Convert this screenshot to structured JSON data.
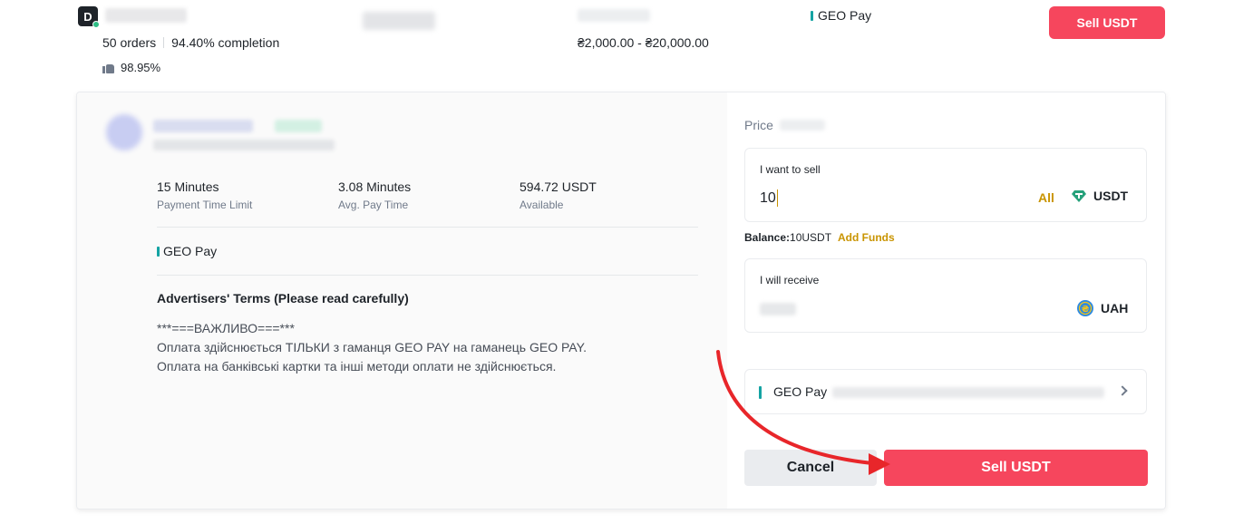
{
  "top_listing": {
    "avatar_letter": "D",
    "orders": "50 orders",
    "completion": "94.40% completion",
    "positive_rate": "98.95%",
    "limit": "₴2,000.00 - ₴20,000.00",
    "payment_method": "GEO Pay",
    "sell_button": "Sell USDT"
  },
  "advertiser": {
    "stats": [
      {
        "value": "15 Minutes",
        "label": "Payment Time Limit"
      },
      {
        "value": "3.08 Minutes",
        "label": "Avg. Pay Time"
      },
      {
        "value": "594.72 USDT",
        "label": "Available"
      }
    ],
    "payment_method": "GEO Pay",
    "terms_title": "Advertisers' Terms (Please read carefully)",
    "terms_lines": [
      "***===ВАЖЛИВО===***",
      "Оплата здійснюється ТІЛЬКИ з гаманця GEO PAY на гаманець GEO PAY.",
      "Оплата на банківські картки та інші методи оплати не здійснюється."
    ]
  },
  "order_form": {
    "price_label": "Price",
    "sell_label": "I want to sell",
    "sell_value": "10",
    "all_label": "All",
    "sell_currency": "USDT",
    "balance_label": "Balance:",
    "balance_value": "10USDT",
    "add_funds": "Add Funds",
    "receive_label": "I will receive",
    "receive_currency": "UAH",
    "payment_method": "GEO Pay",
    "cancel_button": "Cancel",
    "confirm_button": "Sell USDT"
  },
  "colors": {
    "accent_red": "#f6465d",
    "accent_gold": "#c99400",
    "geo_pay_teal": "#14a3a3",
    "annotation_arrow": "#e8262a"
  }
}
